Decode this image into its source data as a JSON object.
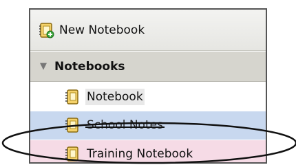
{
  "toolbar": {
    "new_notebook_label": "New Notebook"
  },
  "sidebar": {
    "section_title": "Notebooks",
    "items": [
      {
        "label": "Notebook"
      },
      {
        "label": "School Notes"
      },
      {
        "label": "Training Notebook"
      }
    ]
  },
  "colors": {
    "selected_blue": "#c8d8ef",
    "highlight_pink": "#f6dbe6",
    "header_gray": "#d6d5ce"
  }
}
